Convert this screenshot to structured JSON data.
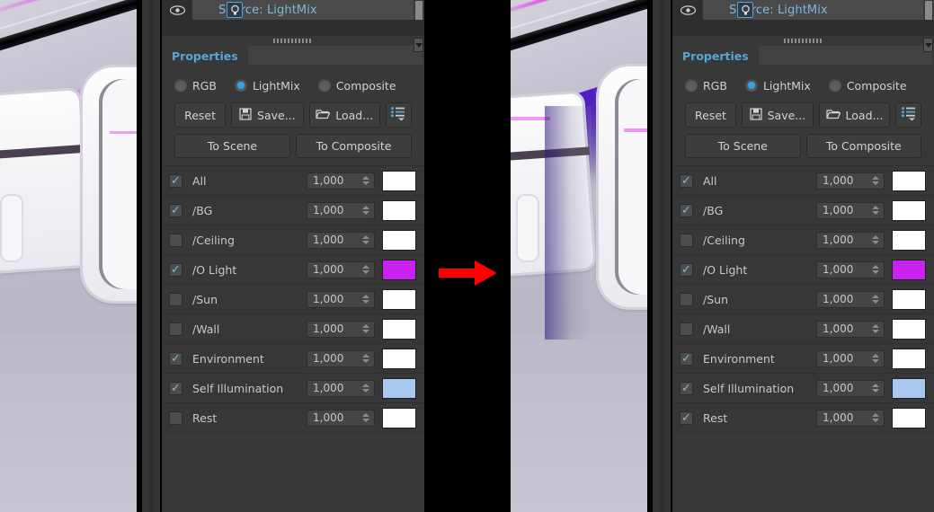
{
  "app": {
    "source_label": "Source: LightMix",
    "source_icon": "lightbulb-icon",
    "visibility_icon": "eye-icon"
  },
  "properties_tab": {
    "label": "Properties"
  },
  "modes": {
    "selected": "LightMix",
    "options": [
      {
        "label": "RGB",
        "selected": false
      },
      {
        "label": "LightMix",
        "selected": true
      },
      {
        "label": "Composite",
        "selected": false
      }
    ]
  },
  "toolbar": {
    "reset_label": "Reset",
    "save_label": "Save...",
    "load_label": "Load...",
    "menu_icon": "list-menu-icon",
    "to_scene_label": "To Scene",
    "to_composite_label": "To Composite"
  },
  "colors": {
    "accent_blue": "#7fb8dd",
    "radio_on": "#31a3e8",
    "magenta_swatch": "#c722ef",
    "blue_swatch": "#a8c8f0",
    "white_swatch": "#ffffff",
    "arrow_red": "#ff0000",
    "panel_bg": "#383838",
    "row_bg": "#373737"
  },
  "left_panel": {
    "rows": [
      {
        "name": "All",
        "checked": true,
        "value": "1,000",
        "color": "#ffffff"
      },
      {
        "name": "/BG",
        "checked": true,
        "value": "1,000",
        "color": "#ffffff"
      },
      {
        "name": "/Ceiling",
        "checked": false,
        "value": "1,000",
        "color": "#ffffff"
      },
      {
        "name": "/O Light",
        "checked": true,
        "value": "1,000",
        "color": "#c722ef"
      },
      {
        "name": "/Sun",
        "checked": false,
        "value": "1,000",
        "color": "#ffffff"
      },
      {
        "name": "/Wall",
        "checked": false,
        "value": "1,000",
        "color": "#ffffff"
      },
      {
        "name": "Environment",
        "checked": true,
        "value": "1,000",
        "color": "#ffffff"
      },
      {
        "name": "Self Illumination",
        "checked": true,
        "value": "1,000",
        "color": "#a8c8f0"
      },
      {
        "name": "Rest",
        "checked": false,
        "value": "1,000",
        "color": "#ffffff"
      }
    ]
  },
  "right_panel": {
    "rows": [
      {
        "name": "All",
        "checked": true,
        "value": "1,000",
        "color": "#ffffff"
      },
      {
        "name": "/BG",
        "checked": true,
        "value": "1,000",
        "color": "#ffffff"
      },
      {
        "name": "/Ceiling",
        "checked": false,
        "value": "1,000",
        "color": "#ffffff"
      },
      {
        "name": "/O Light",
        "checked": true,
        "value": "1,000",
        "color": "#c722ef"
      },
      {
        "name": "/Sun",
        "checked": false,
        "value": "1,000",
        "color": "#ffffff"
      },
      {
        "name": "/Wall",
        "checked": false,
        "value": "1,000",
        "color": "#ffffff"
      },
      {
        "name": "Environment",
        "checked": true,
        "value": "1,000",
        "color": "#ffffff"
      },
      {
        "name": "Self Illumination",
        "checked": true,
        "value": "1,000",
        "color": "#a8c8f0"
      },
      {
        "name": "Rest",
        "checked": true,
        "value": "1,000",
        "color": "#ffffff"
      }
    ]
  },
  "previews": {
    "before": {
      "glow_color": "#d96fe0",
      "glow_strength": "soft"
    },
    "after": {
      "glow_color": "#5a1fd8",
      "glow_strength": "strong"
    }
  },
  "annotation": {
    "arrow_icon": "right-arrow-icon",
    "direction": "right"
  }
}
